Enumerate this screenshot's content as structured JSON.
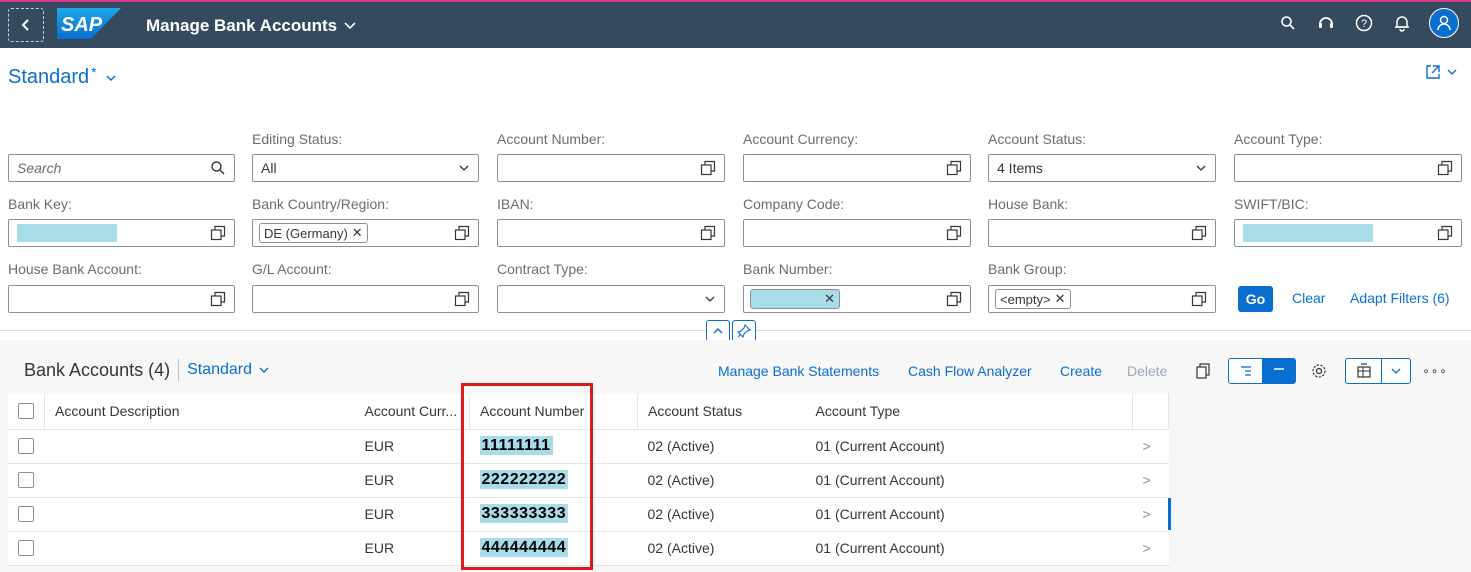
{
  "shell": {
    "app_title": "Manage Bank Accounts",
    "logo_text": "SAP",
    "icons": [
      "search-icon",
      "help-headset-icon",
      "help-icon",
      "notification-bell-icon",
      "user-avatar-icon"
    ],
    "accent": "#354a5f"
  },
  "variant": {
    "name": "Standard",
    "modified_marker": "*"
  },
  "filters": {
    "search_placeholder": "Search",
    "editing_status": {
      "label": "Editing Status:",
      "value": "All"
    },
    "account_number": {
      "label": "Account Number:",
      "value": ""
    },
    "account_currency": {
      "label": "Account Currency:",
      "value": ""
    },
    "account_status": {
      "label": "Account Status:",
      "value": "4 Items"
    },
    "account_type": {
      "label": "Account Type:",
      "value": ""
    },
    "bank_key": {
      "label": "Bank Key:"
    },
    "bank_country": {
      "label": "Bank Country/Region:",
      "token": "DE (Germany)"
    },
    "iban": {
      "label": "IBAN:",
      "value": ""
    },
    "company_code": {
      "label": "Company Code:",
      "value": ""
    },
    "house_bank": {
      "label": "House Bank:",
      "value": ""
    },
    "swift_bic": {
      "label": "SWIFT/BIC:"
    },
    "house_bank_account": {
      "label": "House Bank Account:",
      "value": ""
    },
    "gl_account": {
      "label": "G/L Account:",
      "value": ""
    },
    "contract_type": {
      "label": "Contract Type:",
      "value": ""
    },
    "bank_number": {
      "label": "Bank Number:"
    },
    "bank_group": {
      "label": "Bank Group:",
      "token": "<empty>"
    },
    "go_label": "Go",
    "clear_label": "Clear",
    "adapt_label": "Adapt Filters (6)"
  },
  "table": {
    "title": "Bank Accounts (4)",
    "variant": "Standard",
    "toolbar": {
      "manage_statements": "Manage Bank Statements",
      "cash_flow": "Cash Flow Analyzer",
      "create": "Create",
      "delete": "Delete"
    },
    "columns": [
      "Account Description",
      "Account Curr...",
      "Account Number",
      "Account Status",
      "Account Type"
    ],
    "rows": [
      {
        "description": "",
        "currency": "EUR",
        "number": "11111111",
        "status": "02 (Active)",
        "type": "01 (Current Account)"
      },
      {
        "description": "",
        "currency": "EUR",
        "number": "222222222",
        "status": "02 (Active)",
        "type": "01 (Current Account)"
      },
      {
        "description": "",
        "currency": "EUR",
        "number": "333333333",
        "status": "02 (Active)",
        "type": "01 (Current Account)"
      },
      {
        "description": "",
        "currency": "EUR",
        "number": "444444444",
        "status": "02 (Active)",
        "type": "01 (Current Account)"
      }
    ],
    "nav_glyph": ">"
  }
}
